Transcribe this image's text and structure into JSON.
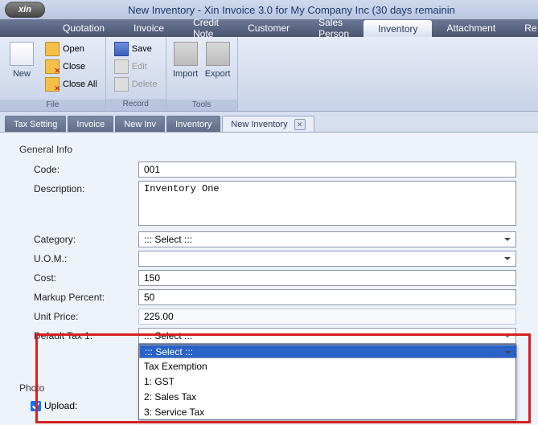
{
  "window": {
    "title": "New Inventory - Xin Invoice 3.0 for My Company Inc (30 days remainin",
    "logo": "xin"
  },
  "mainmenu": {
    "items": [
      "Quotation",
      "Invoice",
      "Credit Note",
      "Customer",
      "Sales Person",
      "Inventory",
      "Attachment",
      "Re"
    ],
    "active_index": 5
  },
  "ribbon": {
    "groups": [
      {
        "label": "File",
        "big": {
          "name": "new",
          "label": "New"
        },
        "small": [
          {
            "name": "open",
            "label": "Open"
          },
          {
            "name": "close",
            "label": "Close"
          },
          {
            "name": "closeall",
            "label": "Close All"
          }
        ]
      },
      {
        "label": "Record",
        "small": [
          {
            "name": "save",
            "label": "Save"
          },
          {
            "name": "edit",
            "label": "Edit",
            "disabled": true
          },
          {
            "name": "delete",
            "label": "Delete",
            "disabled": true
          }
        ]
      },
      {
        "label": "Tools",
        "big2": [
          {
            "name": "import",
            "label": "Import"
          },
          {
            "name": "export",
            "label": "Export"
          }
        ]
      }
    ]
  },
  "innertabs": {
    "items": [
      "Tax Setting",
      "Invoice",
      "New Inv",
      "Inventory",
      "New Inventory"
    ],
    "active_index": 4
  },
  "form": {
    "section": "General Info",
    "code": {
      "label": "Code:",
      "value": "001"
    },
    "description": {
      "label": "Description:",
      "value": "Inventory One"
    },
    "category": {
      "label": "Category:",
      "value": "::: Select :::"
    },
    "uom": {
      "label": "U.O.M.:",
      "value": ""
    },
    "cost": {
      "label": "Cost:",
      "value": "150"
    },
    "markup": {
      "label": "Markup Percent:",
      "value": "50"
    },
    "unitprice": {
      "label": "Unit Price:",
      "value": "225.00"
    },
    "deftax": {
      "label": "Default Tax 1:",
      "value": "::: Select :::",
      "options": [
        "::: Select :::",
        "Tax Exemption",
        "1: GST",
        "2: Sales Tax",
        "3: Service Tax"
      ],
      "highlight_index": 0
    },
    "photo": {
      "label": "Photo"
    },
    "upload": {
      "label": "Upload:",
      "checked": true
    }
  }
}
